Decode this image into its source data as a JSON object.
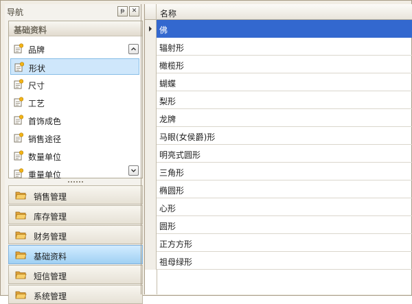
{
  "nav": {
    "title": "导航",
    "pin_glyph": "ᵽ",
    "close_glyph": "✕",
    "panel": {
      "title": "基础资料",
      "items": [
        {
          "label": "品牌"
        },
        {
          "label": "形状",
          "selected": true
        },
        {
          "label": "尺寸"
        },
        {
          "label": "工艺"
        },
        {
          "label": "首饰成色"
        },
        {
          "label": "销售途径"
        },
        {
          "label": "数量单位"
        },
        {
          "label": "重量单位"
        }
      ]
    },
    "groups": [
      {
        "label": "销售管理"
      },
      {
        "label": "库存管理"
      },
      {
        "label": "财务管理"
      },
      {
        "label": "基础资料",
        "active": true
      },
      {
        "label": "短信管理"
      },
      {
        "label": "系统管理"
      }
    ]
  },
  "grid": {
    "column_header": "名称",
    "rows": [
      {
        "name": "佛",
        "selected": true
      },
      {
        "name": "辐射形"
      },
      {
        "name": "橄榄形"
      },
      {
        "name": "蝴蝶"
      },
      {
        "name": "梨形"
      },
      {
        "name": "龙牌"
      },
      {
        "name": "马眼(女侯爵)形"
      },
      {
        "name": "明亮式圆形"
      },
      {
        "name": "三角形"
      },
      {
        "name": "椭圆形"
      },
      {
        "name": "心形"
      },
      {
        "name": "圆形"
      },
      {
        "name": "正方方形"
      },
      {
        "name": "祖母绿形"
      }
    ]
  },
  "colors": {
    "selection": "#3368cf",
    "active_group": "#9fd0f3",
    "frame": "#a79b86"
  }
}
